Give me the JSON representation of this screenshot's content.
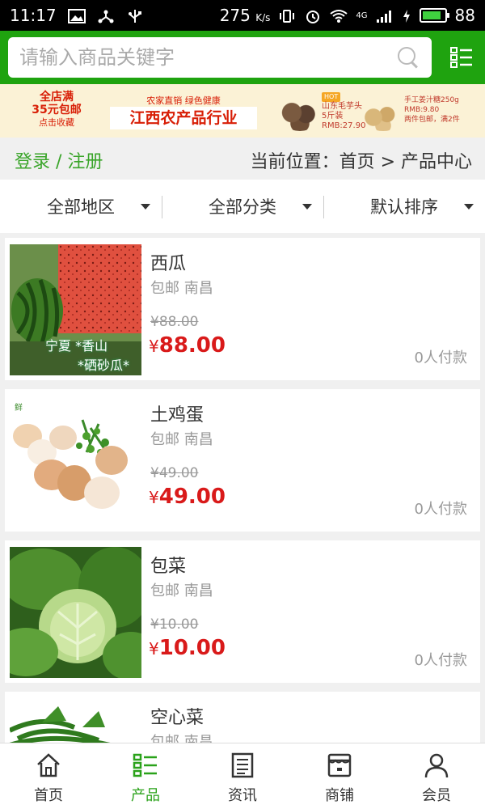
{
  "status_bar": {
    "time": "11:17",
    "speed": "275",
    "speed_unit": "K/s",
    "network": "4G",
    "battery": "88",
    "battery_level": 0.88
  },
  "search": {
    "placeholder": "请输入商品关键字"
  },
  "banner": {
    "promo_line1": "全店满",
    "promo_line2": "35元包邮",
    "promo_line3": "点击收藏",
    "slogan": "农家直销 绿色健康",
    "title": "江西农产品行业",
    "item1_badge": "HOT",
    "item1_name": "山东毛芋头",
    "item1_spec": "5斤装",
    "item1_price": "RMB:27.90",
    "item2_name": "手工姜汁糖250g",
    "item2_price": "RMB:9.80",
    "item2_note": "两件包邮，满2件"
  },
  "location": {
    "login": "登录 / 注册",
    "breadcrumb": "当前位置：首页 > 产品中心"
  },
  "filters": [
    "全部地区",
    "全部分类",
    "默认排序"
  ],
  "products": [
    {
      "name": "西瓜",
      "ship": "包邮 南昌",
      "old_price": "¥88.00",
      "currency": "¥",
      "price": "88.00",
      "paid": "0人付款",
      "img_caption_1": "宁夏 *香山",
      "img_caption_2": "*硒砂瓜*"
    },
    {
      "name": "土鸡蛋",
      "ship": "包邮 南昌",
      "old_price": "¥49.00",
      "currency": "¥",
      "price": "49.00",
      "paid": "0人付款"
    },
    {
      "name": "包菜",
      "ship": "包邮 南昌",
      "old_price": "¥10.00",
      "currency": "¥",
      "price": "10.00",
      "paid": "0人付款"
    },
    {
      "name": "空心菜",
      "ship": "包邮 南昌",
      "old_price": "",
      "currency": "",
      "price": "",
      "paid": ""
    }
  ],
  "nav": [
    {
      "label": "首页",
      "icon": "home-icon"
    },
    {
      "label": "产品",
      "icon": "list-icon",
      "active": true
    },
    {
      "label": "资讯",
      "icon": "news-icon"
    },
    {
      "label": "商铺",
      "icon": "store-icon"
    },
    {
      "label": "会员",
      "icon": "user-icon"
    }
  ],
  "colors": {
    "brand_green": "#1fa30f",
    "price_red": "#d91a1a",
    "link_green": "#3aa52a"
  }
}
